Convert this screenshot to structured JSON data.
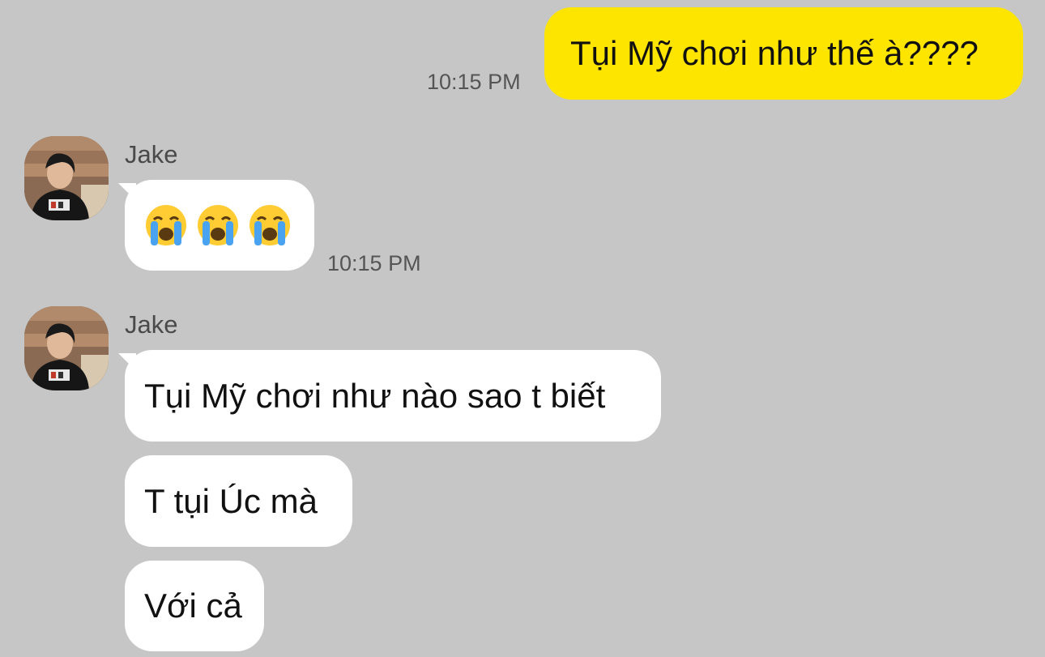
{
  "messages": {
    "m1": {
      "text": "Tụi Mỹ chơi như thế à????",
      "time": "10:15 PM"
    },
    "m2": {
      "sender": "Jake",
      "emoji": [
        "loudly-crying-face",
        "loudly-crying-face",
        "loudly-crying-face"
      ],
      "time": "10:15 PM"
    },
    "m3": {
      "sender": "Jake",
      "text": "Tụi Mỹ chơi như nào sao t biết"
    },
    "m4": {
      "text": "T tụi Úc mà"
    },
    "m5": {
      "text": "Với cả"
    }
  },
  "colors": {
    "background": "#c6c6c6",
    "outgoing_bubble": "#fee500",
    "incoming_bubble": "#ffffff",
    "timestamp": "#555555",
    "sender_name": "#4a4a4a"
  },
  "icons": {
    "avatar": "profile-photo-avatar",
    "emoji": "loudly-crying-face-emoji"
  }
}
